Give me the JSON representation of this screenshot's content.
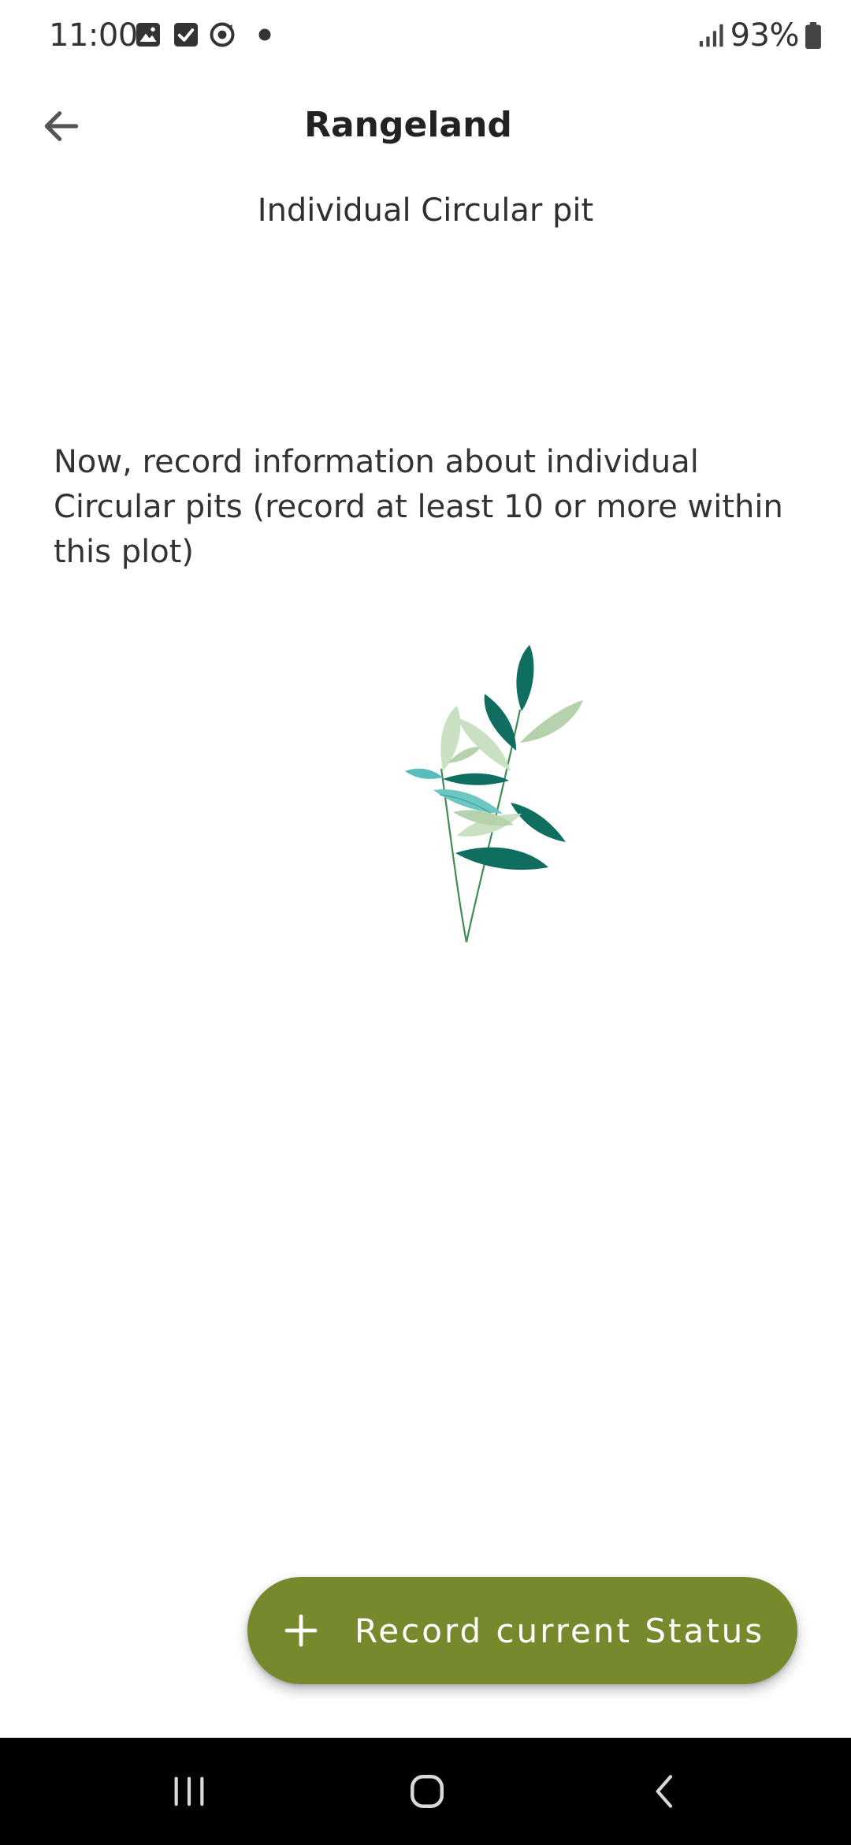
{
  "status_bar": {
    "time": "11:00",
    "notification_icons": [
      "image-icon",
      "checkbox-icon",
      "sync-icon",
      "dot-icon"
    ],
    "signal_icon": "signal-icon",
    "battery_percent": "93%",
    "battery_icon": "battery-icon"
  },
  "header": {
    "back_icon": "arrow-left-icon",
    "title": "Rangeland"
  },
  "page": {
    "subtitle": "Individual Circular pit",
    "instruction": "Now, record information about individual Circular pits (record at least 10 or more within this plot)",
    "illustration": "leaves-illustration"
  },
  "fab": {
    "icon": "plus-icon",
    "label": "Record current Status",
    "color": "#76892c"
  },
  "nav_bar": {
    "buttons": [
      "recent-apps-icon",
      "home-icon",
      "back-chevron-icon"
    ]
  },
  "colors": {
    "accent": "#76892c",
    "leaf_dark": "#0f6e5f",
    "leaf_light": "#b5d2ad",
    "leaf_teal": "#5bbcbc"
  }
}
